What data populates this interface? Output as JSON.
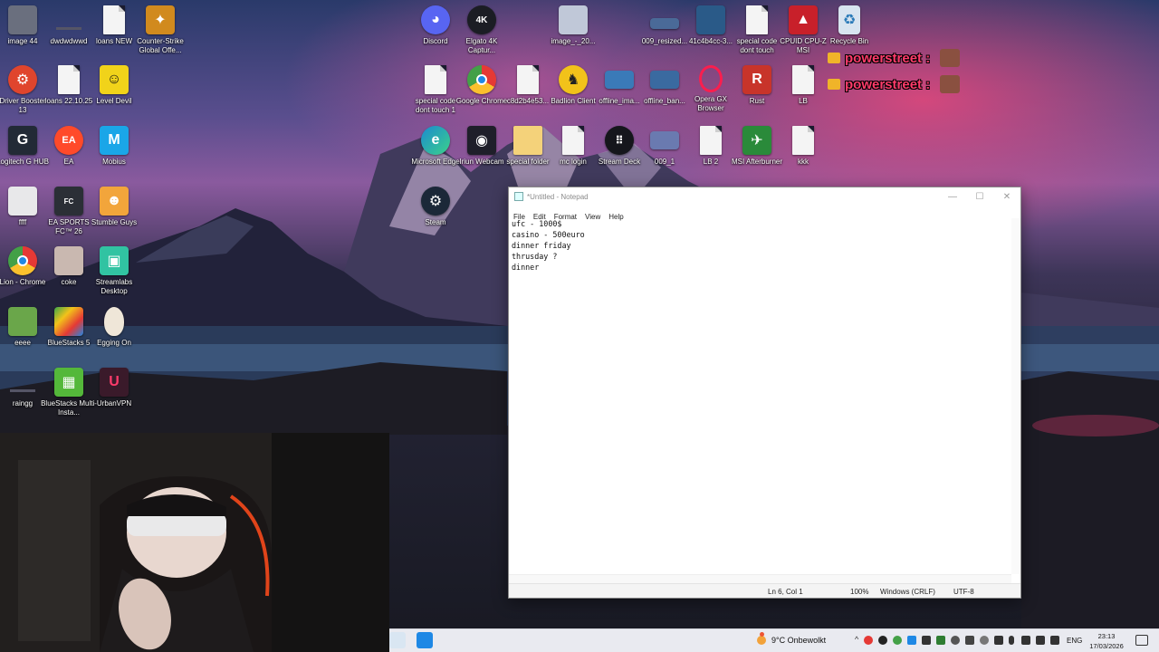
{
  "desktop_icons": [
    {
      "label": "image 44",
      "icon": "image-thumbnail-icon",
      "color": "#6a6f7e"
    },
    {
      "label": "dwdwdwwd",
      "icon": "blank-file-icon",
      "color": "#3b3f52"
    },
    {
      "label": "loans NEW",
      "icon": "text-document-icon",
      "color": "#f4f4f4"
    },
    {
      "label": "Counter-Strike Global Offe...",
      "icon": "cs-go-icon",
      "color": "#d18a1e"
    },
    {
      "label": "Driver Booster 13",
      "icon": "driver-booster-icon",
      "color": "#e0452d"
    },
    {
      "label": "loans 22.10.25",
      "icon": "text-document-icon",
      "color": "#f4f4f4"
    },
    {
      "label": "Level Devil",
      "icon": "level-devil-icon",
      "color": "#f1d31a"
    },
    {
      "label": "Logitech G HUB",
      "icon": "logitech-g-icon",
      "color": "#222a36"
    },
    {
      "label": "EA",
      "icon": "ea-icon",
      "color": "#ff4a2a"
    },
    {
      "label": "Mobius",
      "icon": "mobius-icon",
      "color": "#1aa6e8"
    },
    {
      "label": "ffff",
      "icon": "image-thumbnail-icon",
      "color": "#e8e8ea"
    },
    {
      "label": "EA SPORTS FC™ 26",
      "icon": "ea-fc-icon",
      "color": "#2b2f36"
    },
    {
      "label": "Stumble Guys",
      "icon": "stumble-guys-icon",
      "color": "#f2a53b"
    },
    {
      "label": "Lion - Chrome",
      "icon": "chrome-icon",
      "color": "#2f8a3f"
    },
    {
      "label": "coke",
      "icon": "image-thumbnail-icon",
      "color": "#c9b8b0"
    },
    {
      "label": "Streamlabs Desktop",
      "icon": "streamlabs-icon",
      "color": "#31c3a2"
    },
    {
      "label": "eeee",
      "icon": "image-thumbnail-icon",
      "color": "#6aa64a"
    },
    {
      "label": "BlueStacks 5",
      "icon": "bluestacks-icon",
      "color": "#3aa64a"
    },
    {
      "label": "Egging On",
      "icon": "egg-icon",
      "color": "#efe6d8"
    },
    {
      "label": "raingg",
      "icon": "blank-file-icon",
      "color": "#3b3f52"
    },
    {
      "label": "BlueStacks Multi-Insta...",
      "icon": "bluestacks-multi-icon",
      "color": "#54b83a"
    },
    {
      "label": "UrbanVPN",
      "icon": "urbanvpn-icon",
      "color": "#3a1a2a"
    },
    {
      "label": "Discord",
      "icon": "discord-icon",
      "color": "#5865f2"
    },
    {
      "label": "Elgato 4K Captur...",
      "icon": "elgato-4k-icon",
      "color": "#1b1d24"
    },
    {
      "label": "image_-_20...",
      "icon": "image-thumbnail-icon",
      "color": "#c0c8d8"
    },
    {
      "label": "009_resized...",
      "icon": "image-thumbnail-icon",
      "color": "#4a6a98"
    },
    {
      "label": "41c4b4cc-3...",
      "icon": "image-thumbnail-icon",
      "color": "#2a5a88"
    },
    {
      "label": "special code dont touch",
      "icon": "text-document-icon",
      "color": "#f4f4f4"
    },
    {
      "label": "CPUID CPU-Z MSI",
      "icon": "cpuz-icon",
      "color": "#c8202a"
    },
    {
      "label": "Recycle Bin",
      "icon": "recycle-bin-icon",
      "color": "#d8e4f0"
    },
    {
      "label": "special code dont touch 1",
      "icon": "text-document-icon",
      "color": "#f4f4f4"
    },
    {
      "label": "Google Chrome",
      "icon": "chrome-icon",
      "color": "#2f8a3f"
    },
    {
      "label": "c8d2b4e53...",
      "icon": "text-document-icon",
      "color": "#f4f4f4"
    },
    {
      "label": "Badlion Client",
      "icon": "badlion-icon",
      "color": "#f2c21a"
    },
    {
      "label": "offline_ima...",
      "icon": "image-thumbnail-icon",
      "color": "#3a7ab8"
    },
    {
      "label": "offline_ban...",
      "icon": "image-thumbnail-icon",
      "color": "#3a6aa0"
    },
    {
      "label": "Opera GX Browser",
      "icon": "opera-gx-icon",
      "color": "#fa1e4e"
    },
    {
      "label": "Rust",
      "icon": "rust-icon",
      "color": "#c8342a"
    },
    {
      "label": "LB",
      "icon": "text-document-icon",
      "color": "#f4f4f4"
    },
    {
      "label": "Microsoft Edge",
      "icon": "edge-icon",
      "color": "#1b8ad0"
    },
    {
      "label": "Iriun Webcam",
      "icon": "iriun-webcam-icon",
      "color": "#1f1f2a"
    },
    {
      "label": "special folder",
      "icon": "folder-icon",
      "color": "#f4d27a"
    },
    {
      "label": "mc login",
      "icon": "text-document-icon",
      "color": "#f4f4f4"
    },
    {
      "label": "Stream Deck",
      "icon": "stream-deck-icon",
      "color": "#15161c"
    },
    {
      "label": "009_1",
      "icon": "image-thumbnail-icon",
      "color": "#6a7ab0"
    },
    {
      "label": "LB 2",
      "icon": "text-document-icon",
      "color": "#f4f4f4"
    },
    {
      "label": "MSI Afterburner",
      "icon": "msi-afterburner-icon",
      "color": "#2a8a3a"
    },
    {
      "label": "kkk",
      "icon": "text-document-icon",
      "color": "#f4f4f4"
    },
    {
      "label": "Steam",
      "icon": "steam-icon",
      "color": "#1b2838"
    }
  ],
  "overlay_chat": [
    {
      "name": "powerstreet :"
    },
    {
      "name": "powerstreet :"
    }
  ],
  "notepad": {
    "title": "*Untitled - Notepad",
    "menu": [
      "File",
      "Edit",
      "Format",
      "View",
      "Help"
    ],
    "lines": [
      "ufc - 1000$",
      "casino - 500euro",
      "dinner friday",
      "thrusday ?",
      "dinner"
    ],
    "status": {
      "position": "Ln 6, Col 1",
      "zoom": "100%",
      "line_ending": "Windows (CRLF)",
      "encoding": "UTF-8"
    }
  },
  "taskbar": {
    "weather": "9°C  Onbewolkt",
    "language": "ENG",
    "time": "23:13",
    "date": "17/03/2026",
    "tray_colors": [
      "#e53935",
      "#222222",
      "#43a047",
      "#1e88e5",
      "#333333",
      "#2e7d32",
      "#555555",
      "#444444",
      "#777777",
      "#333333",
      "#333333",
      "#333333",
      "#333333",
      "#333333",
      "#333333",
      "#333333"
    ]
  },
  "colors": {
    "accent": "#ff3b6b",
    "taskbar_bg": "#e9eaf0"
  }
}
